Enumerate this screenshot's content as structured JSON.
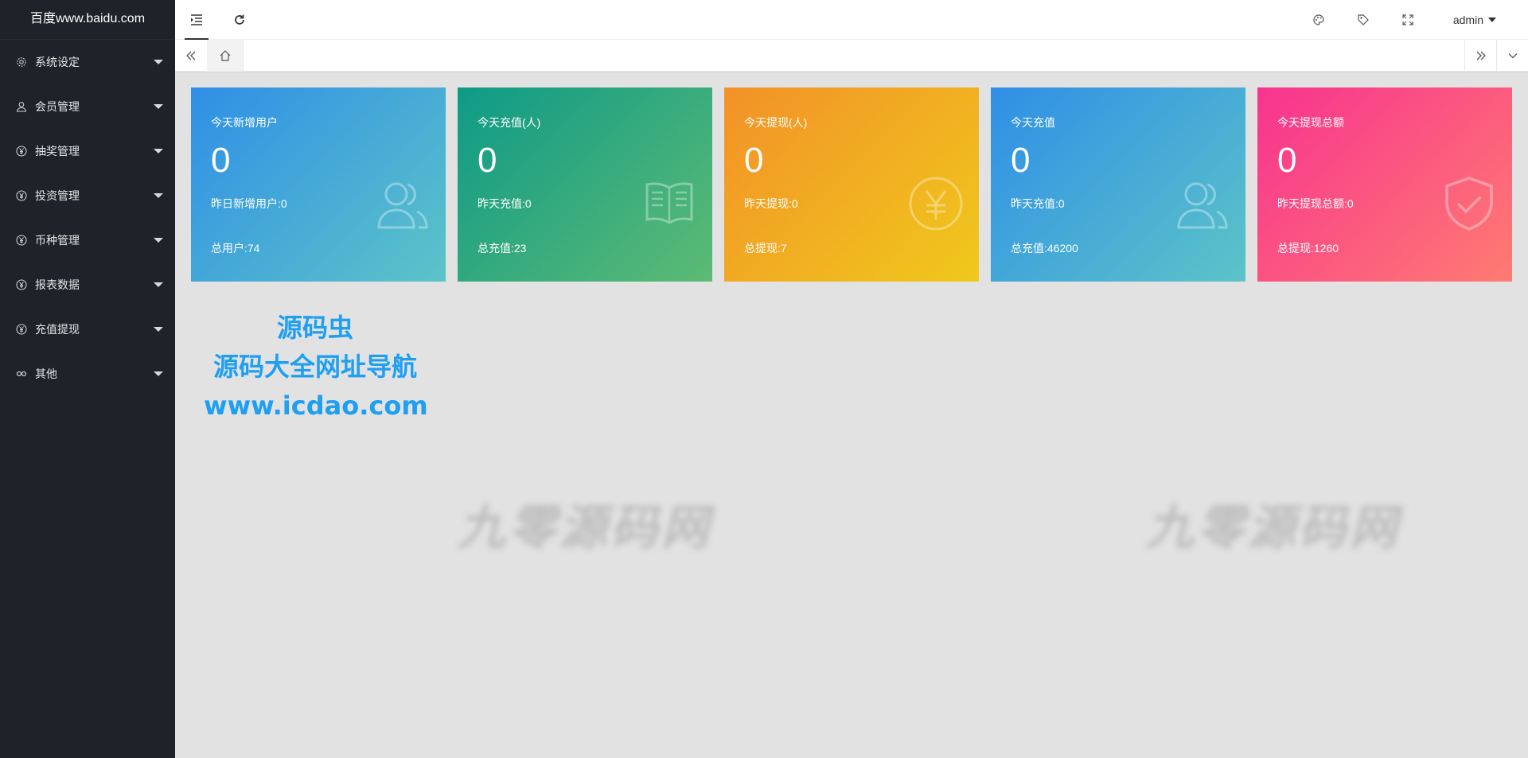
{
  "app": {
    "logo_text": "百度www.baidu.com"
  },
  "sidebar": {
    "items": [
      {
        "label": "系统设定",
        "icon": "gear-icon"
      },
      {
        "label": "会员管理",
        "icon": "user-icon"
      },
      {
        "label": "抽奖管理",
        "icon": "yen-icon"
      },
      {
        "label": "投资管理",
        "icon": "yen-icon"
      },
      {
        "label": "币种管理",
        "icon": "yen-icon"
      },
      {
        "label": "报表数据",
        "icon": "yen-icon"
      },
      {
        "label": "充值提现",
        "icon": "yen-icon"
      },
      {
        "label": "其他",
        "icon": "link-icon"
      }
    ]
  },
  "header": {
    "user": "admin"
  },
  "cards": [
    {
      "title": "今天新增用户",
      "value": "0",
      "yesterday": "昨日新增用户:0",
      "total": "总用户:74",
      "icon": "users-icon",
      "colors": [
        "#2f8fe6",
        "#5cc4c8"
      ]
    },
    {
      "title": "今天充值(人)",
      "value": "0",
      "yesterday": "昨天充值:0",
      "total": "总充值:23",
      "icon": "book-icon",
      "colors": [
        "#0e9a87",
        "#5dbb74"
      ]
    },
    {
      "title": "今天提现(人)",
      "value": "0",
      "yesterday": "昨天提现:0",
      "total": "总提现:7",
      "icon": "yen-circle-icon",
      "colors": [
        "#f29128",
        "#f0c91c"
      ]
    },
    {
      "title": "今天充值",
      "value": "0",
      "yesterday": "昨天充值:0",
      "total": "总充值:46200",
      "icon": "users-icon",
      "colors": [
        "#2f8fe6",
        "#5cc4c8"
      ]
    },
    {
      "title": "今天提现总额",
      "value": "0",
      "yesterday": "昨天提现总额:0",
      "total": "总提现:1260",
      "icon": "shield-check-icon",
      "colors": [
        "#f7338f",
        "#ff7b72"
      ]
    }
  ],
  "promo": {
    "line1": "源码虫",
    "line2": "源码大全网址导航",
    "line3": "www.icdao.com"
  },
  "watermark": {
    "text": "九零源码网"
  }
}
